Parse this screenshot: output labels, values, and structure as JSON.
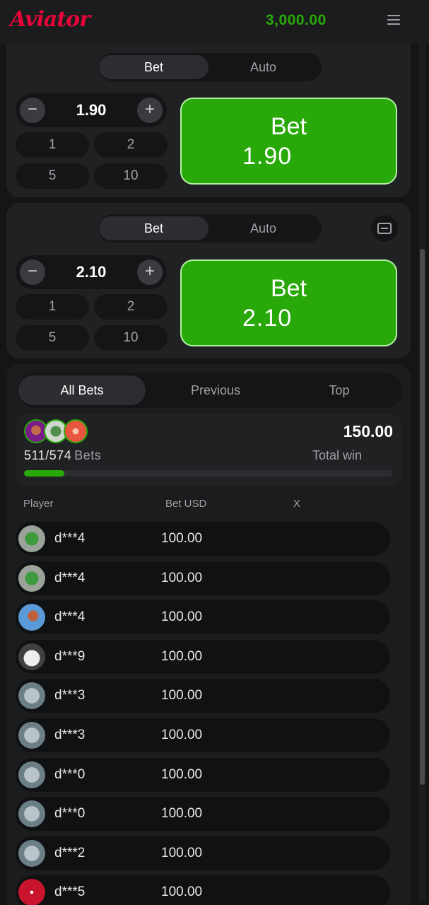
{
  "header": {
    "logo": "Aviator",
    "balance": "3,000.00",
    "menu_icon": "hamburger-menu-icon"
  },
  "bet_panels": [
    {
      "tabs": [
        "Bet",
        "Auto"
      ],
      "active_tab": "Bet",
      "amount": "1.90",
      "quick_amounts": [
        "1",
        "2",
        "5",
        "10"
      ],
      "button_label": "Bet",
      "button_amount": "1.90"
    },
    {
      "tabs": [
        "Bet",
        "Auto"
      ],
      "active_tab": "Bet",
      "amount": "2.10",
      "quick_amounts": [
        "1",
        "2",
        "5",
        "10"
      ],
      "button_label": "Bet",
      "button_amount": "2.10",
      "collapse_icon": "minus-square-icon"
    }
  ],
  "bets_list": {
    "tabs": [
      "All Bets",
      "Previous",
      "Top"
    ],
    "active_tab": "All Bets",
    "summary": {
      "count": "511/574",
      "count_label": "Bets",
      "total_win": "150.00",
      "total_win_label": "Total win",
      "progress_fraction": 0.11
    },
    "columns": [
      "Player",
      "Bet USD",
      "X"
    ],
    "rows": [
      {
        "player": "d***4",
        "bet": "100.00",
        "avatar": "clover-icon"
      },
      {
        "player": "d***4",
        "bet": "100.00",
        "avatar": "clover-icon"
      },
      {
        "player": "d***4",
        "bet": "100.00",
        "avatar": "bird-icon"
      },
      {
        "player": "d***9",
        "bet": "100.00",
        "avatar": "toilet-icon"
      },
      {
        "player": "d***3",
        "bet": "100.00",
        "avatar": "money-icon"
      },
      {
        "player": "d***3",
        "bet": "100.00",
        "avatar": "money-icon"
      },
      {
        "player": "d***0",
        "bet": "100.00",
        "avatar": "money-icon"
      },
      {
        "player": "d***0",
        "bet": "100.00",
        "avatar": "money-icon"
      },
      {
        "player": "d***2",
        "bet": "100.00",
        "avatar": "money-icon"
      },
      {
        "player": "d***5",
        "bet": "100.00",
        "avatar": "dice-icon"
      }
    ]
  },
  "colors": {
    "accent_green": "#28a909",
    "logo_red": "#e50539",
    "panel_bg": "#202123"
  }
}
